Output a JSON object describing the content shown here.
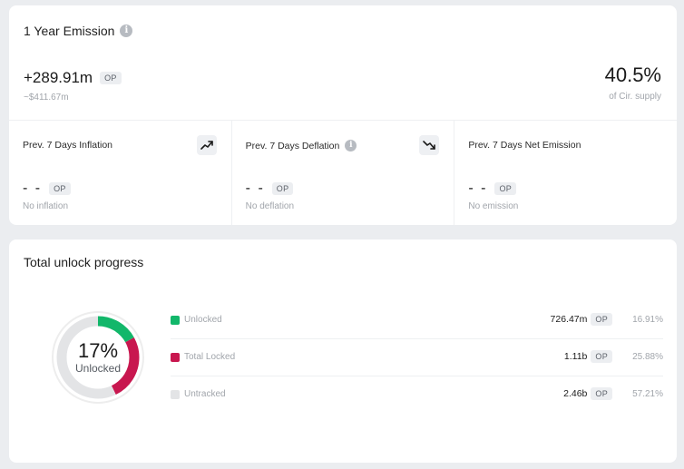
{
  "emission": {
    "title": "1 Year Emission",
    "amount": "+289.91m",
    "token": "OP",
    "usd": "~$411.67m",
    "percent": "40.5%",
    "percent_label": "of Cir. supply"
  },
  "stats": [
    {
      "label": "Prev. 7 Days Inflation",
      "value": "- -",
      "token": "OP",
      "sub": "No inflation",
      "icon": "trend-up-icon"
    },
    {
      "label": "Prev. 7 Days Deflation",
      "value": "- -",
      "token": "OP",
      "sub": "No deflation",
      "icon": "trend-down-icon"
    },
    {
      "label": "Prev. 7 Days Net Emission",
      "value": "- -",
      "token": "OP",
      "sub": "No emission"
    }
  ],
  "unlock": {
    "title": "Total unlock progress",
    "center_percent": "17%",
    "center_label": "Unlocked",
    "items": [
      {
        "name": "Unlocked",
        "amount": "726.47m",
        "token": "OP",
        "percent": "16.91%",
        "fraction": 0.1691,
        "color": "#12b76a"
      },
      {
        "name": "Total Locked",
        "amount": "1.11b",
        "token": "OP",
        "percent": "25.88%",
        "fraction": 0.2588,
        "color": "#c8174f"
      },
      {
        "name": "Untracked",
        "amount": "2.46b",
        "token": "OP",
        "percent": "57.21%",
        "fraction": 0.5721,
        "color": "#e3e4e6"
      }
    ]
  }
}
